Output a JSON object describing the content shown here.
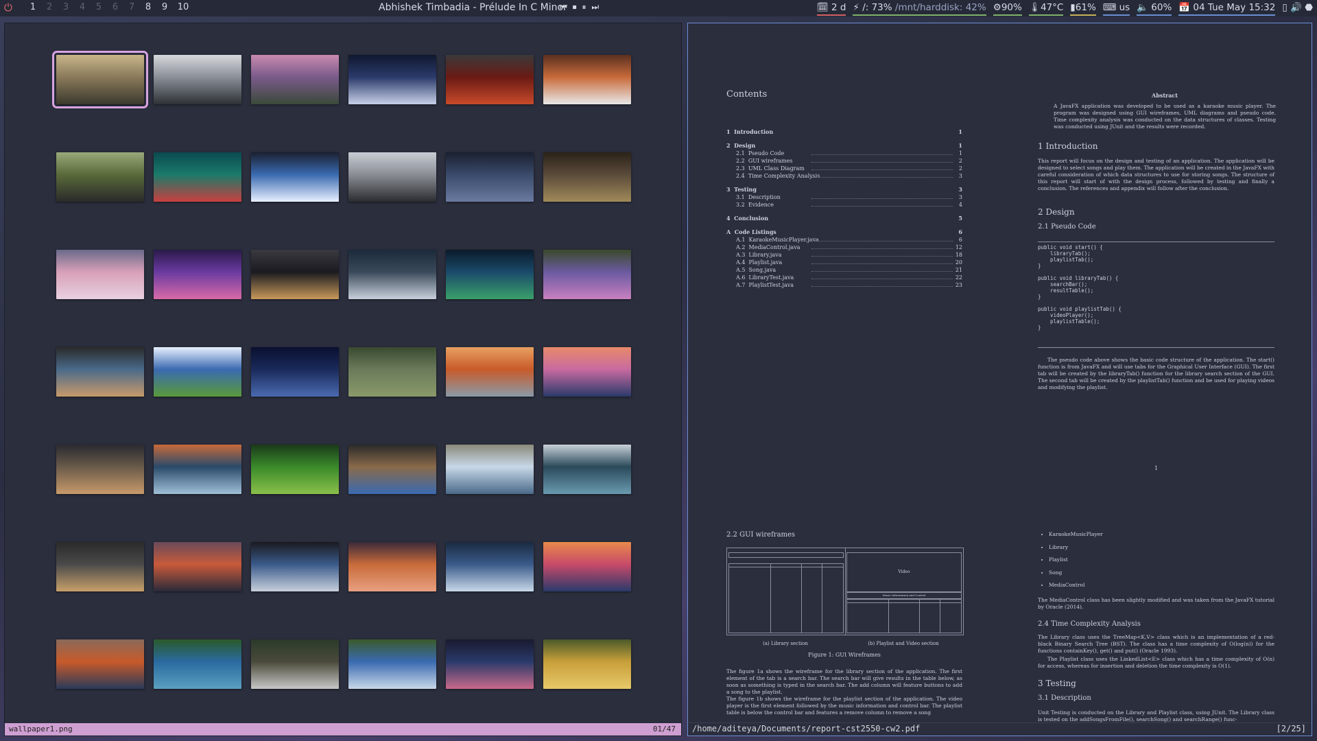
{
  "topbar": {
    "power_icon": "power-icon",
    "workspaces": [
      "1",
      "2",
      "3",
      "4",
      "5",
      "6",
      "7",
      "8",
      "9",
      "10"
    ],
    "occupied": [
      0,
      7,
      8,
      9
    ],
    "now_playing": "Abhishek Timbadia - Prélude In C Minor",
    "media_controls": [
      "⏮",
      "⏹",
      "⏸",
      "⏭"
    ],
    "status": {
      "updates": "2 d",
      "root_disk": "/: 73%",
      "harddisk": "/mnt/harddisk: 42%",
      "cpu": "90%",
      "temp": "47°C",
      "memory": "61%",
      "keyboard": "us",
      "volume": "60%",
      "datetime": "04 Tue May 15:32"
    }
  },
  "left_window": {
    "filename": "wallpaper1.png",
    "counter": "01/47",
    "thumbnails": [
      [
        "#8a7a5a",
        "#3b3a2e",
        "#c8b58a"
      ],
      [
        "#8a8f98",
        "#2e3236",
        "#d6d8dc"
      ],
      [
        "#7a5a8a",
        "#3a4a3a",
        "#c98ab0"
      ],
      [
        "#2a3a6a",
        "#c8d0e8",
        "#101830"
      ],
      [
        "#6a1a14",
        "#c84a2a",
        "#3a3a3a"
      ],
      [
        "#c86a3a",
        "#e8e8e8",
        "#5a3020"
      ],
      [
        "#5a6a3a",
        "#2a2a2a",
        "#9aa87a"
      ],
      [
        "#1a7a6a",
        "#c84040",
        "#0a4a50"
      ],
      [
        "#3a6ab0",
        "#e8f0ff",
        "#1a2030"
      ],
      [
        "#8a8e94",
        "#2a2c30",
        "#c8ccd4"
      ],
      [
        "#3a4a6a",
        "#6a7aa0",
        "#1a2030"
      ],
      [
        "#5a4a3a",
        "#a08a5a",
        "#2a2218"
      ],
      [
        "#d8a0b8",
        "#e8d0e0",
        "#6a6a8a"
      ],
      [
        "#6a3aa0",
        "#d86aa8",
        "#2a1a4a"
      ],
      [
        "#1a1a20",
        "#c89a5a",
        "#3a3a40"
      ],
      [
        "#3a4a5a",
        "#c8d0dc",
        "#1a2a3a"
      ],
      [
        "#1a4a6a",
        "#3aa06a",
        "#0a1a2a"
      ],
      [
        "#6a5aa0",
        "#c880c0",
        "#3a4a2a"
      ],
      [
        "#4a6a8a",
        "#c89a6a",
        "#2a2a2a"
      ],
      [
        "#3a6ab0",
        "#5a9a3a",
        "#e8f0ff"
      ],
      [
        "#1a2a5a",
        "#4a6ab0",
        "#0a1030"
      ],
      [
        "#6a7a5a",
        "#8a9a6a",
        "#3a4a30"
      ],
      [
        "#c85a2a",
        "#8a9aa8",
        "#e8a060"
      ],
      [
        "#c86aa0",
        "#2a3a6a",
        "#e88a6a"
      ],
      [
        "#6a5a4a",
        "#c89a6a",
        "#2a2a30"
      ],
      [
        "#2a4a6a",
        "#a0c0d8",
        "#c86a3a"
      ],
      [
        "#3a8a2a",
        "#8ac04a",
        "#1a3a1a"
      ],
      [
        "#8a6a4a",
        "#3a6ab0",
        "#2a2a2a"
      ],
      [
        "#c8d8e8",
        "#4a6a8a",
        "#8a8a7a"
      ],
      [
        "#2a4a5a",
        "#6a9ab0",
        "#c8d0d8"
      ],
      [
        "#4a4a4a",
        "#c8a06a",
        "#2a2a2a"
      ],
      [
        "#c85a3a",
        "#2a2a3a",
        "#6a4a5a"
      ],
      [
        "#3a5a8a",
        "#c8d0dc",
        "#1a1a20"
      ],
      [
        "#c86a3a",
        "#e8a080",
        "#3a2a3a"
      ],
      [
        "#3a5a8a",
        "#c8d8e8",
        "#1a2a40"
      ],
      [
        "#c84a6a",
        "#2a3a6a",
        "#e88a4a"
      ],
      [
        "#c85a2a",
        "#2a3a5a",
        "#8a6a5a"
      ],
      [
        "#2a6aa0",
        "#5aa0c0",
        "#2a5a2a"
      ],
      [
        "#4a4a3a",
        "#c8c8c8",
        "#2a3a2a"
      ],
      [
        "#3a6ab0",
        "#c8d8e8",
        "#3a5a2a"
      ],
      [
        "#2a3a6a",
        "#c86a8a",
        "#1a1a30"
      ],
      [
        "#c8a03a",
        "#e8c86a",
        "#4a5a2a"
      ]
    ]
  },
  "pdf": {
    "filepath": "/home/aditeya/Documents/report-cst2550-cw2.pdf",
    "page_indicator": "[2/25]",
    "contents_title": "Contents",
    "toc": [
      {
        "n": "1",
        "t": "Introduction",
        "p": "1",
        "lvl": 0
      },
      {
        "n": "2",
        "t": "Design",
        "p": "1",
        "lvl": 0
      },
      {
        "n": "2.1",
        "t": "Pseudo Code",
        "p": "1",
        "lvl": 1
      },
      {
        "n": "2.2",
        "t": "GUI wireframes",
        "p": "2",
        "lvl": 1
      },
      {
        "n": "2.3",
        "t": "UML Class Diagram",
        "p": "2",
        "lvl": 1
      },
      {
        "n": "2.4",
        "t": "Time Complexity Analysis",
        "p": "3",
        "lvl": 1
      },
      {
        "n": "3",
        "t": "Testing",
        "p": "3",
        "lvl": 0
      },
      {
        "n": "3.1",
        "t": "Description",
        "p": "3",
        "lvl": 1
      },
      {
        "n": "3.2",
        "t": "Evidence",
        "p": "4",
        "lvl": 1
      },
      {
        "n": "4",
        "t": "Conclusion",
        "p": "5",
        "lvl": 0
      },
      {
        "n": "A",
        "t": "Code Listings",
        "p": "6",
        "lvl": 0
      },
      {
        "n": "A.1",
        "t": "KaraokeMusicPlayer.java",
        "p": "6",
        "lvl": 1
      },
      {
        "n": "A.2",
        "t": "MediaControl.java",
        "p": "12",
        "lvl": 1
      },
      {
        "n": "A.3",
        "t": "Library.java",
        "p": "18",
        "lvl": 1
      },
      {
        "n": "A.4",
        "t": "Playlist.java",
        "p": "20",
        "lvl": 1
      },
      {
        "n": "A.5",
        "t": "Song.java",
        "p": "21",
        "lvl": 1
      },
      {
        "n": "A.6",
        "t": "LibraryTest.java",
        "p": "22",
        "lvl": 1
      },
      {
        "n": "A.7",
        "t": "PlaylistTest.java",
        "p": "23",
        "lvl": 1
      }
    ],
    "abstract_title": "Abstract",
    "abstract_text": "A JavaFX application was developed to be used as a karaoke music player. The program was designed using GUI wireframes, UML diagrams and pseudo code. Time complexity analysis was conducted on the data structures of classes. Testing was conducted using JUnit and the results were recorded.",
    "h_intro": "1   Introduction",
    "intro_text": "This report will focus on the design and testing of an application. The application will be designed to select songs and play them. The application will be created in the JavaFX with careful consideration of which data structures to use for storing songs. The structure of this report will start of with the design process, followed by testing and finally a conclusion. The references and appendix will follow after the conclusion.",
    "h_design": "2   Design",
    "h_pseudo": "2.1   Pseudo Code",
    "code": "public void start() {\n    libraryTab();\n    playlistTab();\n}\n\npublic void libraryTab() {\n    searchBar();\n    resultTable();\n}\n\npublic void playlistTab() {\n    videoPlayer();\n    playlistTable();\n}",
    "pseudo_text": "The pseudo code above shows the basic code structure of the application. The start() function is from JavaFX and will use tabs for the Graphical User Interface (GUI). The first tab will be created by the libraryTab() function for the library search section of the GUI. The second tab will be created by the playlistTab() function and be used for playing videos and modifying the playlist.",
    "page_number": "1",
    "h_wire": "2.2   GUI wireframes",
    "wire_video": "Video",
    "wire_music": "Music Information and Control",
    "cap_a": "(a) Library section",
    "cap_b": "(b) Playlist and Video section",
    "fig_cap": "Figure 1: GUI Wireframes",
    "wire_text": "The figure 1a shows the wireframe for the library section of the application. The first element of the tab is a search bar. The search bar will give results in the table below, as soon as something is typed in the search bar. The add column will feature buttons to add a song to the playlist.\n    The figure 1b shows the wireframe for the playlist section of the application. The video player is the first element followed by the music information and control bar. The playlist table is below the control bar and features a remove column to remove a song",
    "bullets": [
      "KaraokeMusicPlayer",
      "Library",
      "Playlist",
      "Song",
      "MediaControl"
    ],
    "mc_text": "The MediaControl class has been slightly modified and was taken from the JavaFX tutorial by Oracle (2014).",
    "h_tca": "2.4   Time Complexity Analysis",
    "tca_text1": "The Library class uses the TreeMap<K,V> class which is an implementation of a red-black Binary Search Tree (BST). The class has a time complexity of O(log(n)) for the functions containKey(), get() and put() (Oracle 1993).",
    "tca_text2": "The Playlist class uses the LinkedList<E> class which has a time complexity of O(n) for access, whereas for insertion and deletion the time complexity is O(1).",
    "h_testing": "3   Testing",
    "h_desc": "3.1   Description",
    "desc_text": "Unit Testing is conducted on the Library and Playlist class, using JUnit. The Library class is tested on the addSongsFromFile(), searchSong() and searchRange() func-"
  }
}
